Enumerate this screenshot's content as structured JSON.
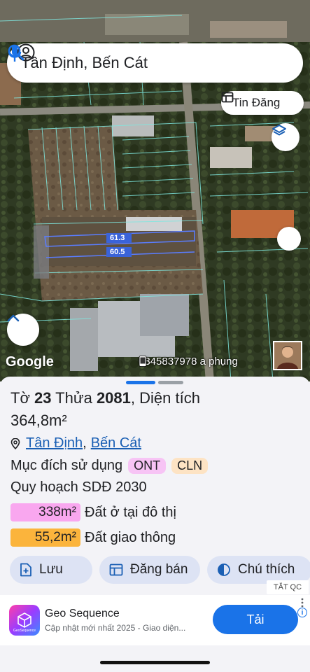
{
  "search": {
    "query": "Tân Định, Bến Cát"
  },
  "map": {
    "listing_chip": "Tin Đăng",
    "attribution": "Google",
    "contact_text": "0345837978 a phụng",
    "measurements": [
      "61.3",
      "60.5"
    ]
  },
  "parcel": {
    "title_prefix": "Tờ ",
    "sheet_no": "23",
    "title_mid": " Thửa ",
    "parcel_no": "2081",
    "title_suffix": ", Diện tích",
    "area": "364,8m²",
    "ward": "Tân Định",
    "district": "Bến Cát",
    "separator": ",",
    "purpose_label": "Mục đích sử dụng",
    "purpose_tags": [
      "ONT",
      "CLN"
    ],
    "plan_label": "Quy hoạch SDĐ 2030",
    "zones": [
      {
        "area": "338m²",
        "label": "Đất ở tại đô thị",
        "color": "#f9a7ef"
      },
      {
        "area": "55,2m²",
        "label": "Đất giao thông",
        "color": "#fbb43c"
      }
    ]
  },
  "actions": [
    {
      "label": "Lưu",
      "icon": "save-plus-icon"
    },
    {
      "label": "Đăng bán",
      "icon": "listing-icon"
    },
    {
      "label": "Chú thích",
      "icon": "half-circle-icon"
    }
  ],
  "ad": {
    "badge": "TẮT QC",
    "logo_text": "GeoSequence",
    "app_name": "Geo Sequence",
    "description": "Cập nhật mới nhất 2025 - Giao diện...",
    "cta": "Tải",
    "info": "i"
  },
  "colors": {
    "accent": "#1a73e8",
    "zone_residential": "#f9a7ef",
    "zone_traffic": "#fbb43c",
    "action_bg": "#dde3f4"
  }
}
